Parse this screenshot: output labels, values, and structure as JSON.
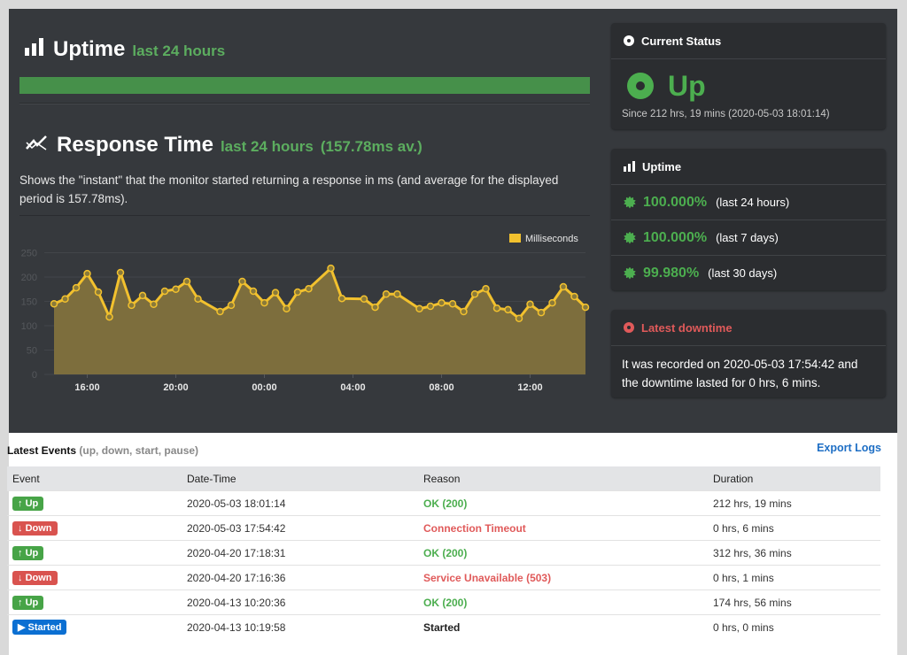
{
  "uptime_section": {
    "title": "Uptime",
    "subtitle": "last 24 hours",
    "uptime_fraction": 1.0
  },
  "response_section": {
    "title": "Response Time",
    "subtitle": "last 24 hours",
    "average": "(157.78ms av.)",
    "description": "Shows the \"instant\" that the monitor started returning a response in ms (and average for the displayed period is 157.78ms)."
  },
  "chart_data": {
    "type": "area",
    "title": "",
    "xlabel": "",
    "ylabel": "",
    "legend": [
      "Milliseconds"
    ],
    "legend_position": "top-right",
    "series_color": "#f2c12e",
    "fill_color": "#7d6e3d",
    "ylim": [
      0,
      275
    ],
    "y_ticks": [
      0,
      50,
      100,
      150,
      200,
      250
    ],
    "x_tick_labels": [
      "16:00",
      "20:00",
      "00:00",
      "04:00",
      "08:00",
      "12:00"
    ],
    "x_tick_index": [
      3,
      11,
      19,
      27,
      35,
      43
    ],
    "series": [
      {
        "name": "Milliseconds",
        "values": [
          145,
          155,
          178,
          207,
          169,
          118,
          209,
          142,
          162,
          144,
          171,
          175,
          191,
          155,
          null,
          129,
          142,
          191,
          171,
          147,
          168,
          135,
          169,
          176,
          null,
          218,
          156,
          null,
          155,
          138,
          165,
          165,
          null,
          135,
          140,
          147,
          145,
          129,
          165,
          176,
          136,
          133,
          115,
          144,
          127,
          147,
          180,
          160,
          138
        ]
      }
    ]
  },
  "current_status": {
    "title": "Current Status",
    "state": "Up",
    "since": "Since 212 hrs, 19 mins (2020-05-03 18:01:14)"
  },
  "uptime_panel": {
    "title": "Uptime",
    "rows": [
      {
        "pct": "100.000%",
        "label": "(last 24 hours)"
      },
      {
        "pct": "100.000%",
        "label": "(last 7 days)"
      },
      {
        "pct": "99.980%",
        "label": "(last 30 days)"
      }
    ]
  },
  "latest_downtime": {
    "title": "Latest downtime",
    "text": "It was recorded on 2020-05-03 17:54:42 and the downtime lasted for 0 hrs, 6 mins."
  },
  "events": {
    "title": "Latest Events",
    "subtitle": "(up, down, start, pause)",
    "export_label": "Export Logs",
    "columns": [
      "Event",
      "Date-Time",
      "Reason",
      "Duration"
    ],
    "rows": [
      {
        "event": "Up",
        "type": "up",
        "datetime": "2020-05-03 18:01:14",
        "reason": "OK (200)",
        "duration": "212 hrs, 19 mins"
      },
      {
        "event": "Down",
        "type": "down",
        "datetime": "2020-05-03 17:54:42",
        "reason": "Connection Timeout",
        "duration": "0 hrs, 6 mins"
      },
      {
        "event": "Up",
        "type": "up",
        "datetime": "2020-04-20 17:18:31",
        "reason": "OK (200)",
        "duration": "312 hrs, 36 mins"
      },
      {
        "event": "Down",
        "type": "down",
        "datetime": "2020-04-20 17:16:36",
        "reason": "Service Unavailable (503)",
        "duration": "0 hrs, 1 mins"
      },
      {
        "event": "Up",
        "type": "up",
        "datetime": "2020-04-13 10:20:36",
        "reason": "OK (200)",
        "duration": "174 hrs, 56 mins"
      },
      {
        "event": "Started",
        "type": "start",
        "datetime": "2020-04-13 10:19:58",
        "reason": "Started",
        "duration": "0 hrs, 0 mins"
      }
    ]
  },
  "colors": {
    "up": "#4cae4f",
    "down": "#e05a5a",
    "start": "#0b6fd2",
    "dark_bg": "#36393d"
  }
}
